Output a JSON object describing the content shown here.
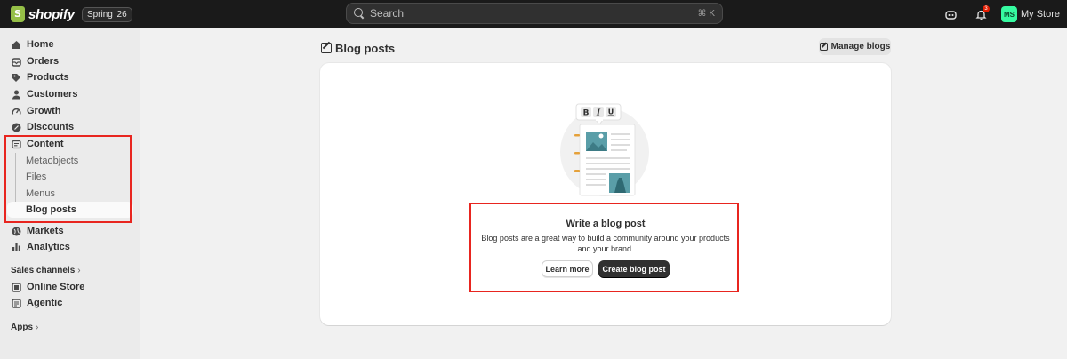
{
  "topbar": {
    "brand": "shopify",
    "edition": "Spring '26",
    "search_placeholder": "Search",
    "search_shortcut": "⌘ K",
    "notification_count": "3",
    "avatar_initials": "MS",
    "store_name": "My Store"
  },
  "sidebar": {
    "items": [
      {
        "label": "Home",
        "icon": "home-icon"
      },
      {
        "label": "Orders",
        "icon": "orders-icon"
      },
      {
        "label": "Products",
        "icon": "tag-icon"
      },
      {
        "label": "Customers",
        "icon": "person-icon"
      },
      {
        "label": "Growth",
        "icon": "gauge-icon"
      },
      {
        "label": "Discounts",
        "icon": "discount-icon"
      },
      {
        "label": "Content",
        "icon": "content-icon"
      }
    ],
    "content_sub": [
      "Metaobjects",
      "Files",
      "Menus",
      "Blog posts"
    ],
    "items_after": [
      {
        "label": "Markets",
        "icon": "globe-icon"
      },
      {
        "label": "Analytics",
        "icon": "bar-chart-icon"
      }
    ],
    "sales_channels_label": "Sales channels",
    "channels": [
      {
        "label": "Online Store",
        "icon": "store-icon"
      },
      {
        "label": "Agentic",
        "icon": "agentic-icon"
      }
    ],
    "apps_label": "Apps"
  },
  "main": {
    "title": "Blog posts",
    "manage_label": "Manage blogs",
    "empty_state": {
      "heading": "Write a blog post",
      "description": "Blog posts are a great way to build a community around your products and your brand.",
      "secondary_label": "Learn more",
      "primary_label": "Create blog post"
    }
  },
  "colors": {
    "highlight": "#e8251f",
    "primary_button": "#303030",
    "brand_green": "#95bf47"
  }
}
